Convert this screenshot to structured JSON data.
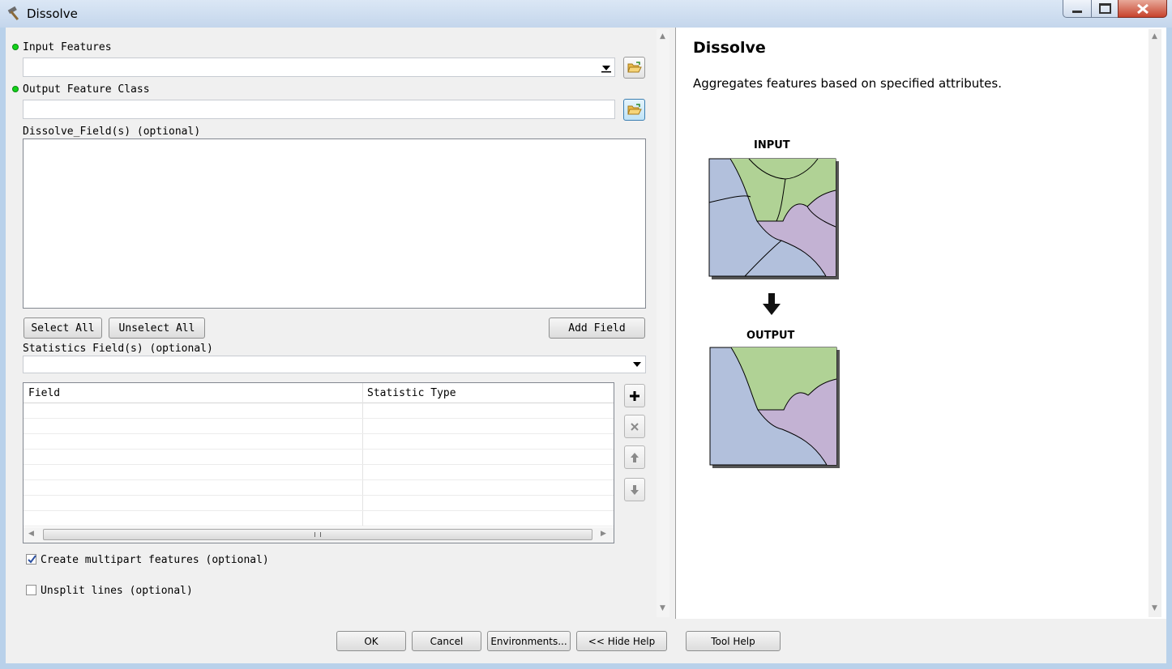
{
  "window": {
    "title": "Dissolve",
    "icon": "hammer-icon"
  },
  "form": {
    "input_features": {
      "label": "Input Features",
      "value": ""
    },
    "output_feature_class": {
      "label": "Output Feature Class",
      "value": ""
    },
    "dissolve_fields": {
      "label": "Dissolve_Field(s) (optional)",
      "items": []
    },
    "select_all": "Select All",
    "unselect_all": "Unselect All",
    "add_field": "Add Field",
    "statistics_fields": {
      "label": "Statistics Field(s) (optional)",
      "value": ""
    },
    "table": {
      "columns": [
        "Field",
        "Statistic Type"
      ],
      "rows": []
    },
    "create_multipart": {
      "label": "Create multipart features (optional)",
      "checked": true
    },
    "unsplit_lines": {
      "label": "Unsplit lines (optional)",
      "checked": false
    }
  },
  "help": {
    "title": "Dissolve",
    "description": "Aggregates features based on specified attributes.",
    "input_label": "INPUT",
    "output_label": "OUTPUT",
    "colors": {
      "blue": "#b2c0dc",
      "green": "#b0d295",
      "purple": "#c3b2d3"
    }
  },
  "buttons": {
    "ok": "OK",
    "cancel": "Cancel",
    "environments": "Environments...",
    "hide_help": "<< Hide Help",
    "tool_help": "Tool Help"
  }
}
